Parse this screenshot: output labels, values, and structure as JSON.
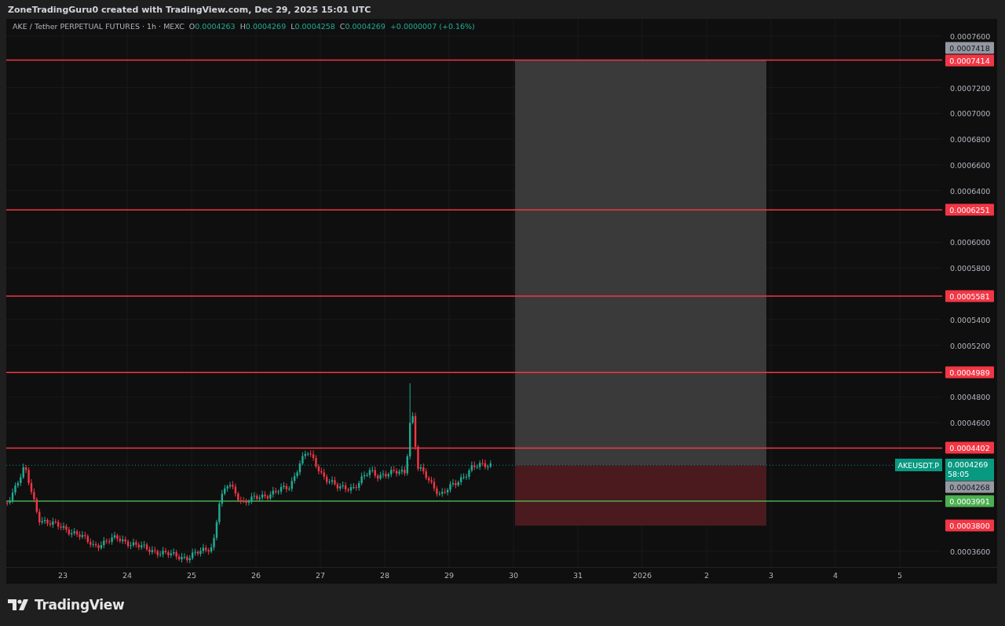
{
  "attribution": "ZoneTradingGuru0 created with TradingView.com, Dec 29, 2025 15:01 UTC",
  "legend": {
    "symbol": "AKE / Tether PERPETUAL FUTURES · 1h · MEXC",
    "ohlc": [
      {
        "key": "O",
        "value": "0.0004263"
      },
      {
        "key": "H",
        "value": "0.0004269"
      },
      {
        "key": "L",
        "value": "0.0004258"
      },
      {
        "key": "C",
        "value": "0.0004269"
      }
    ],
    "change": "+0.0000007 (+0.16%)"
  },
  "price_ticks": [
    "0.0007600",
    "0.0007200",
    "0.0007000",
    "0.0006800",
    "0.0006600",
    "0.0006400",
    "0.0006000",
    "0.0005800",
    "0.0005400",
    "0.0005200",
    "0.0004800",
    "0.0004600",
    "0.0003600"
  ],
  "levels": [
    {
      "kind": "tag",
      "label": "0.0007418",
      "color": "#9598a1"
    },
    {
      "kind": "line",
      "label": "0.0007414",
      "color": "#f23645"
    },
    {
      "kind": "line",
      "label": "0.0006251",
      "color": "#f23645"
    },
    {
      "kind": "line",
      "label": "0.0005581",
      "color": "#f23645"
    },
    {
      "kind": "line",
      "label": "0.0004989",
      "color": "#f23645"
    },
    {
      "kind": "line",
      "label": "0.0004402",
      "color": "#f23645"
    },
    {
      "kind": "tag",
      "label": "0.0004268",
      "color": "#9598a1"
    },
    {
      "kind": "line",
      "label": "0.0003991",
      "color": "#4caf50"
    },
    {
      "kind": "tag",
      "label": "0.0003800",
      "color": "#f23645"
    }
  ],
  "last_price": {
    "symbol": "AKEUSDT.P",
    "price": "0.0004269",
    "countdown": "58:05"
  },
  "time_ticks": [
    "23",
    "24",
    "25",
    "26",
    "27",
    "28",
    "29",
    "30",
    "31",
    "2026",
    "2",
    "3",
    "4",
    "5"
  ],
  "logo": "TradingView"
}
